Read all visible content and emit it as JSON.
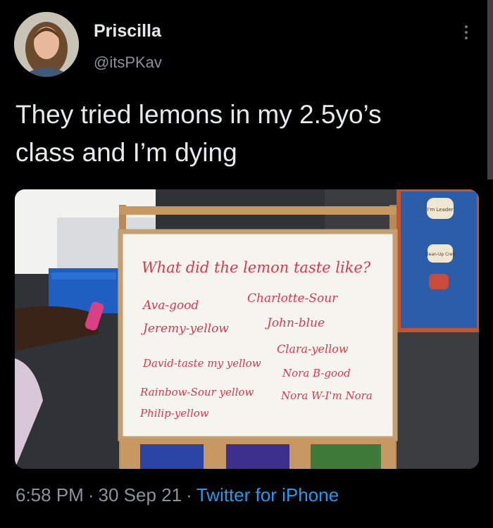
{
  "author": {
    "name": "Priscilla",
    "handle": "@itsPKav"
  },
  "tweet": {
    "text_line1": "They tried lemons in my 2.5yo’s",
    "text_line2": "class and I’m dying"
  },
  "photo": {
    "board_title": "What did the lemon taste like?",
    "left_col": [
      "Ava-good",
      "Jeremy-yellow",
      "David-taste my yellow",
      "Rainbow-Sour yellow",
      "Philip-yellow"
    ],
    "right_col": [
      "Charlotte-Sour",
      "John-blue",
      "Clara-yellow",
      "Nora B-good",
      "Nora W-I'm Nora"
    ],
    "sign_top": "I'm Leader",
    "sign_mid": "Clean-Up Crew"
  },
  "meta": {
    "time": "6:58 PM",
    "date": "30 Sep 21",
    "source": "Twitter for iPhone",
    "separator": "·"
  },
  "colors": {
    "link": "#1d9bf0",
    "marker": "#d9394f"
  }
}
